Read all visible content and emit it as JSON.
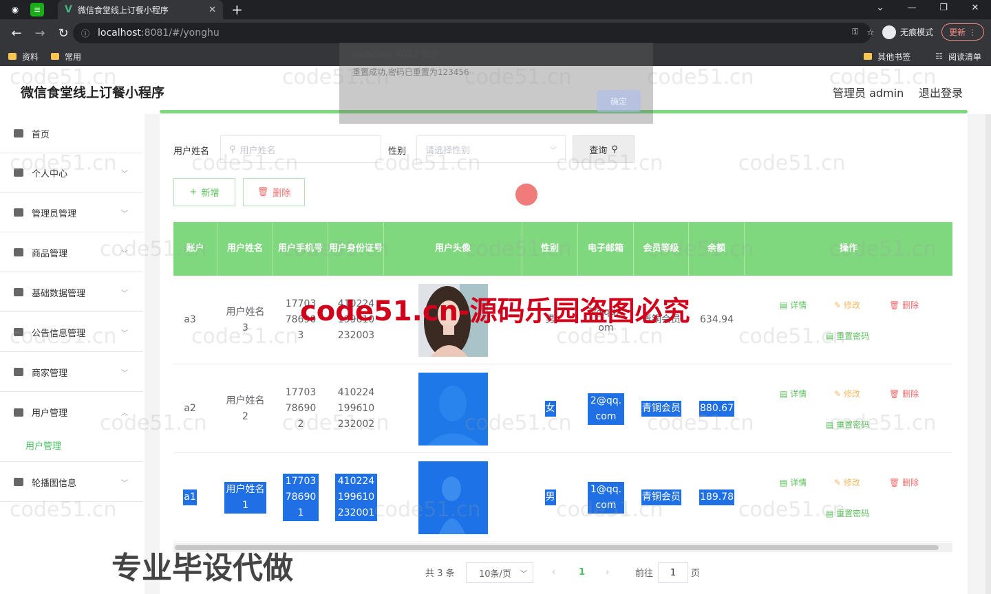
{
  "browser": {
    "tab_title": "微信食堂线上订餐小程序",
    "url_host": "localhost",
    "url_rest": ":8081/#/yonghu",
    "incognito_label": "无痕模式",
    "update_label": "更新",
    "bookmarks": [
      "资料",
      "常用"
    ],
    "bookmarks_right": [
      "其他书签",
      "阅读清单"
    ]
  },
  "dialog": {
    "title": "localhost:8081 显示",
    "message": "重置成功,密码已重置为123456",
    "ok_label": "确定"
  },
  "header": {
    "app_title": "微信食堂线上订餐小程序",
    "user_label": "管理员 admin",
    "logout_label": "退出登录"
  },
  "sidebar": {
    "items": [
      {
        "label": "首页",
        "icon": "home-icon"
      },
      {
        "label": "个人中心",
        "icon": "user-icon"
      },
      {
        "label": "管理员管理",
        "icon": "admin-icon"
      },
      {
        "label": "商品管理",
        "icon": "goods-icon"
      },
      {
        "label": "基础数据管理",
        "icon": "data-icon"
      },
      {
        "label": "公告信息管理",
        "icon": "notice-icon"
      },
      {
        "label": "商家管理",
        "icon": "shop-icon"
      },
      {
        "label": "用户管理",
        "icon": "users-icon"
      },
      {
        "label": "轮播图信息",
        "icon": "carousel-icon"
      }
    ],
    "sub_item": "用户管理"
  },
  "search": {
    "name_label": "用户姓名",
    "name_placeholder": "用户姓名",
    "gender_label": "性别",
    "gender_placeholder": "请选择性别",
    "query_label": "查询"
  },
  "actions": {
    "add_label": "新增",
    "delete_label": "删除"
  },
  "table": {
    "headers": [
      "账户",
      "用户姓名",
      "用户手机号",
      "用户身份证号",
      "用户头像",
      "性别",
      "电子邮箱",
      "会员等级",
      "余额",
      "操作"
    ],
    "rows": [
      {
        "account": "a3",
        "name": "用户姓名3",
        "phone": "17703786903",
        "idcard": "410224199610232003",
        "gender": "男",
        "email": "3@qq.com",
        "level": "青铜会员",
        "balance": "634.94"
      },
      {
        "account": "a2",
        "name": "用户姓名2",
        "phone": "17703786902",
        "idcard": "410224199610232002",
        "gender": "女",
        "email": "2@qq.com",
        "level": "青铜会员",
        "balance": "880.67"
      },
      {
        "account": "a1",
        "name": "用户姓名1",
        "phone": "17703786901",
        "idcard": "410224199610232001",
        "gender": "男",
        "email": "1@qq.com",
        "level": "青铜会员",
        "balance": "189.78"
      }
    ],
    "op_labels": {
      "detail": "详情",
      "edit": "修改",
      "delete": "删除",
      "reset": "重置密码"
    }
  },
  "pagination": {
    "total": "共 3 条",
    "page_size": "10条/页",
    "current_page": "1",
    "goto_label": "前往",
    "goto_value": "1",
    "page_unit": "页"
  },
  "watermarks": {
    "site": "code51.cn",
    "red_text": "code51.cn-源码乐园盗图必究",
    "bottom_text": "专业毕设代做"
  }
}
